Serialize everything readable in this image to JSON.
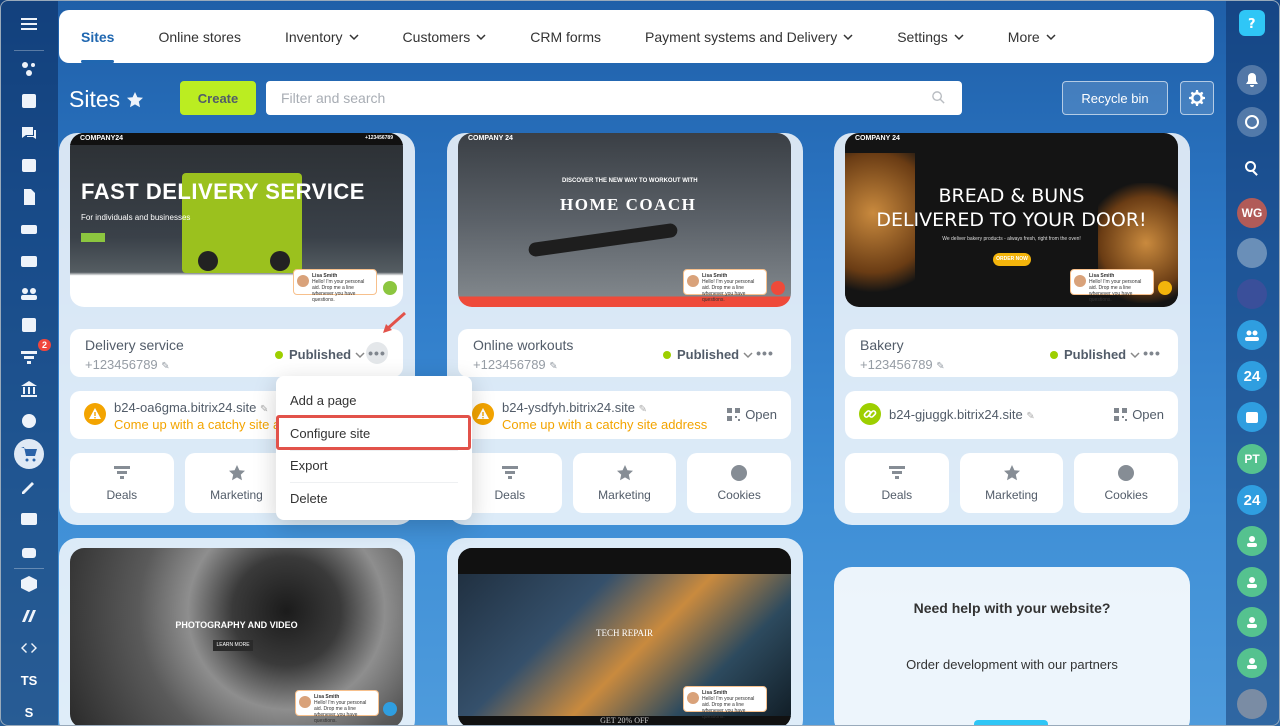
{
  "nav": {
    "tabs": [
      {
        "label": "Sites"
      },
      {
        "label": "Online stores"
      },
      {
        "label": "Inventory"
      },
      {
        "label": "Customers"
      },
      {
        "label": "CRM forms"
      },
      {
        "label": "Payment systems and Delivery"
      },
      {
        "label": "Settings"
      },
      {
        "label": "More"
      }
    ]
  },
  "toolbar": {
    "title": "Sites",
    "create_label": "Create",
    "search_placeholder": "Filter and search",
    "recycle_label": "Recycle bin"
  },
  "left_sidebar": {
    "badge_count": "2",
    "ts_label": "TS",
    "s_label": "S"
  },
  "right_sidebar": {
    "avatar_wg": "WG",
    "avatar_pt": "PT",
    "b24_label": "24"
  },
  "sites": [
    {
      "name": "Delivery service",
      "phone": "+123456789",
      "status": "Published",
      "domain": "b24-oa6gma.bitrix24.site",
      "domain_note": "Come up with a catchy site address",
      "preview": {
        "logo": "COMPANY24",
        "headline": "FAST DELIVERY SERVICE",
        "sub": "For individuals and businesses",
        "topright": "+123456789"
      }
    },
    {
      "name": "Online workouts",
      "phone": "+123456789",
      "status": "Published",
      "domain": "b24-ysdfyh.bitrix24.site",
      "domain_note": "Come up with a catchy site address",
      "open_label": "Open",
      "preview": {
        "logo": "COMPANY 24",
        "headline": "HOME COACH",
        "sub": "DISCOVER THE NEW WAY TO WORKOUT WITH"
      }
    },
    {
      "name": "Bakery",
      "phone": "+123456789",
      "status": "Published",
      "domain": "b24-gjuggk.bitrix24.site",
      "open_label": "Open",
      "preview": {
        "logo": "COMPANY 24",
        "headline1": "BREAD & BUNS",
        "headline2": "DELIVERED TO YOUR DOOR!",
        "sub": "We deliver bakery products - always fresh, right from the oven!",
        "cta": "ORDER NOW"
      }
    }
  ],
  "tiles": {
    "deals": "Deals",
    "marketing": "Marketing",
    "cookies": "Cookies"
  },
  "dropdown": {
    "items": [
      {
        "label": "Add a page"
      },
      {
        "label": "Configure site"
      },
      {
        "label": "Export"
      },
      {
        "label": "Delete"
      }
    ]
  },
  "chat": {
    "name": "Lisa Smith",
    "text": "Hello! I'm your personal aid. Drop me a line whenever you have questions."
  },
  "bottom_previews": {
    "photo": {
      "headline": "PHOTOGRAPHY AND VIDEO",
      "btn": "LEARN MORE"
    },
    "repair": {
      "headline": "TECH REPAIR",
      "footer": "GET 20% OFF"
    }
  },
  "help": {
    "title": "Need help with your website?",
    "text": "Order development with our partners"
  },
  "colors": {
    "accent": "#2067b0",
    "create": "#bbed21",
    "published": "#9dcf00",
    "warning": "#f3a400",
    "highlight": "#e2524a"
  }
}
